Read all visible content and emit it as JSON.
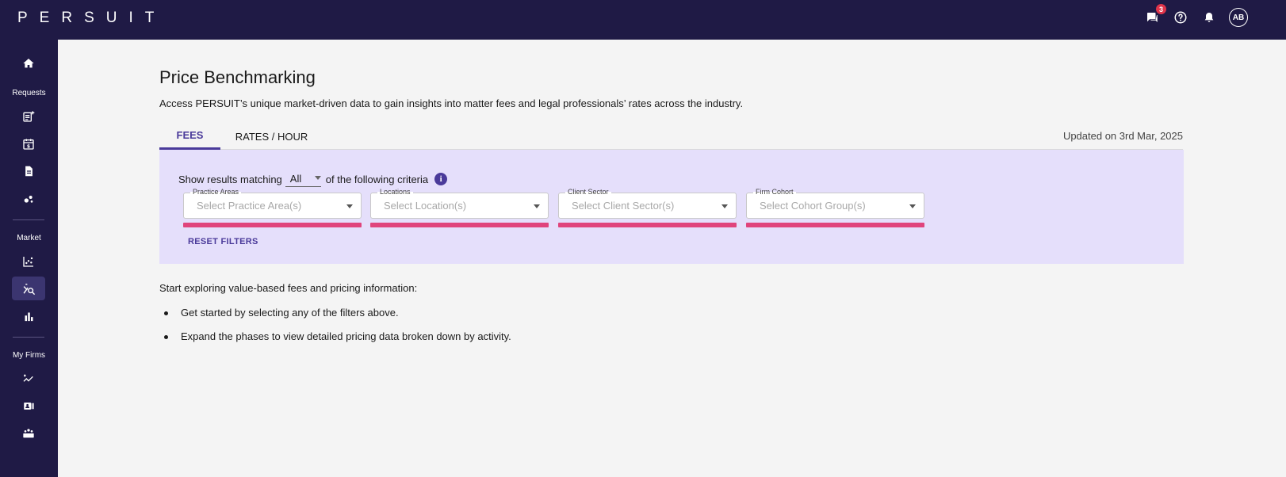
{
  "app": {
    "logo": "PERSUIT",
    "notification_count": "3",
    "avatar_initials": "AB"
  },
  "sidebar": {
    "sections": {
      "requests": "Requests",
      "market": "Market",
      "my_firms": "My Firms"
    },
    "icons": [
      "home-icon",
      "new-request-icon",
      "billing-calendar-icon",
      "document-icon",
      "analytics-icon",
      "scatter-chart-icon",
      "price-benchmark-icon",
      "bar-chart-icon",
      "trending-icon",
      "firm-card-icon",
      "team-icon"
    ]
  },
  "page": {
    "title": "Price Benchmarking",
    "description": "Access PERSUIT’s unique market-driven data to gain insights into matter fees and legal professionals’ rates across the industry.",
    "updated": "Updated on 3rd Mar, 2025"
  },
  "tabs": [
    {
      "label": "FEES",
      "active": true
    },
    {
      "label": "RATES / HOUR",
      "active": false
    }
  ],
  "filters": {
    "criteria_prefix": "Show results matching",
    "criteria_value": "All",
    "criteria_suffix": "of the following criteria",
    "info_glyph": "i",
    "fields": [
      {
        "label": "Practice Areas",
        "placeholder": "Select Practice Area(s)"
      },
      {
        "label": "Locations",
        "placeholder": "Select Location(s)"
      },
      {
        "label": "Client Sector",
        "placeholder": "Select Client Sector(s)"
      },
      {
        "label": "Firm Cohort",
        "placeholder": "Select Cohort Group(s)"
      }
    ],
    "reset_label": "RESET FILTERS"
  },
  "intro": {
    "heading": "Start exploring value-based fees and pricing information:",
    "bullets": [
      "Get started by selecting any of the filters above.",
      "Expand the phases to view detailed pricing data broken down by activity."
    ]
  },
  "colors": {
    "nav_bg": "#1f1a45",
    "accent": "#4a3a9a",
    "filter_panel_bg": "#e5dffb",
    "field_underline": "#e0447c",
    "badge": "#e0344a"
  }
}
